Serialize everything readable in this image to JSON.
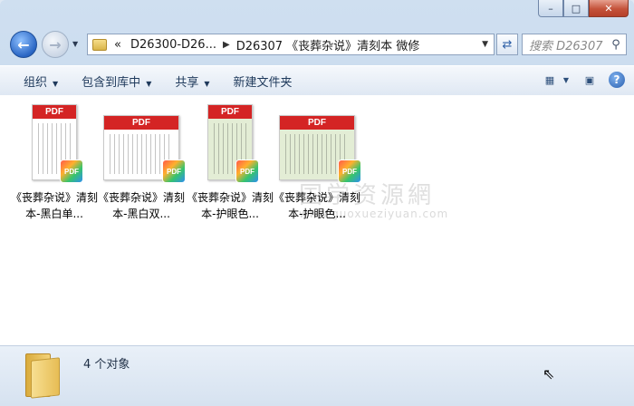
{
  "window": {
    "caption_min": "–",
    "caption_max": "□",
    "caption_close": "✕"
  },
  "nav": {
    "history_arrow": "▼",
    "breadcrumb_lead": "«",
    "crumb1": "D26300-D26...",
    "crumb2": "D26307 《丧葬杂说》清刻本 微修",
    "search_placeholder": "搜索 D26307 ..."
  },
  "toolbar": {
    "organize": "组织",
    "include_library": "包含到库中",
    "share": "共享",
    "new_folder": "新建文件夹"
  },
  "files": [
    {
      "name": "《丧葬杂说》清刻本-黑白单...",
      "variant": "bw-single"
    },
    {
      "name": "《丧葬杂说》清刻本-黑白双...",
      "variant": "bw-double"
    },
    {
      "name": "《丧葬杂说》清刻本-护眼色...",
      "variant": "green-single"
    },
    {
      "name": "《丧葬杂说》清刻本-护眼色...",
      "variant": "green-double"
    }
  ],
  "thumb_band_text": "PDF",
  "thumb_badge_text": "PDF",
  "watermark": {
    "main": "国学资源網",
    "sub": "www.guoxueziyuan.com"
  },
  "status": {
    "count_text": "4 个对象"
  }
}
